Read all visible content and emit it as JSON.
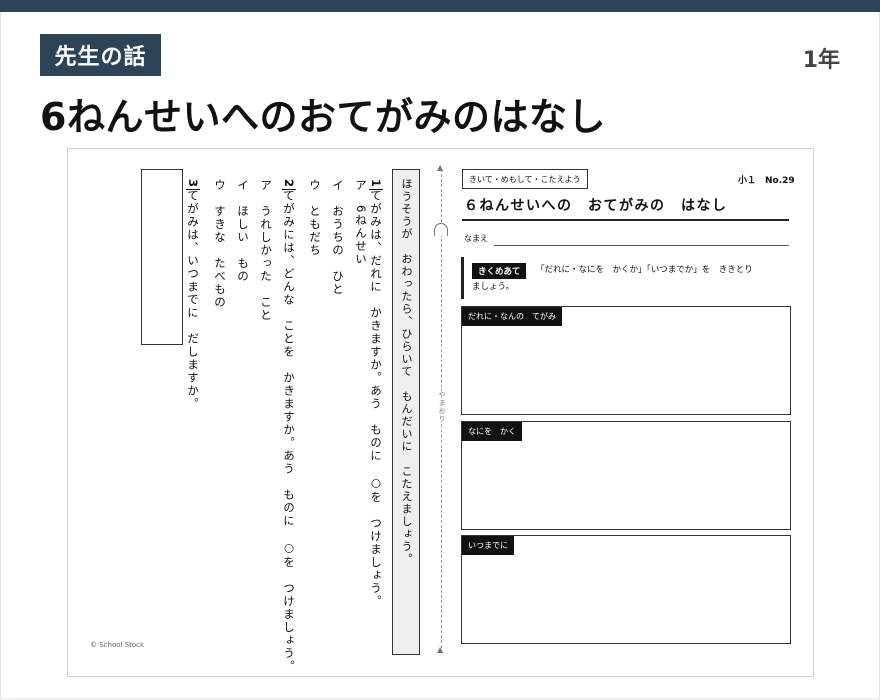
{
  "header": {
    "badge": "先生の話",
    "grade": "1年",
    "title": "6ねんせいへのおてがみのはなし"
  },
  "worksheet": {
    "left_page": {
      "instruction": "ほうそうが　おわったら、ひらいて　もんだいに　こたえましょう。",
      "q1": {
        "number": "1",
        "text": "てがみは、だれに　かきますか。あう　ものに　○を　つけましょう。",
        "options": [
          "ア　6ねんせい",
          "イ　おうちの　ひと",
          "ウ　ともだち"
        ]
      },
      "q2": {
        "number": "2",
        "text": "てがみには、どんな　ことを　かきますか。あう　ものに　○を　つけましょう。",
        "options": [
          "ア　うれしかった　こと",
          "イ　ほしい　もの",
          "ウ　すきな　たべもの"
        ]
      },
      "q3": {
        "number": "3",
        "text": "てがみは、いつまでに　だしますか。"
      },
      "fold_label": "やまおり",
      "copyright": "© School Stock"
    },
    "right_page": {
      "tag": "きいて・めもして・こたえよう",
      "number": "小１　No.29",
      "title": "６ねんせいへの　おてがみの　はなし",
      "name_label": "なまえ",
      "hint_label": "きくめあて",
      "hint_text_1": "「だれに・なにを　かくか」「いつまでか」を　ききとり",
      "hint_text_2": "ましょう。",
      "fields": [
        "だれに・なんの　てがみ",
        "なにを　かく",
        "いつまでに"
      ]
    }
  }
}
